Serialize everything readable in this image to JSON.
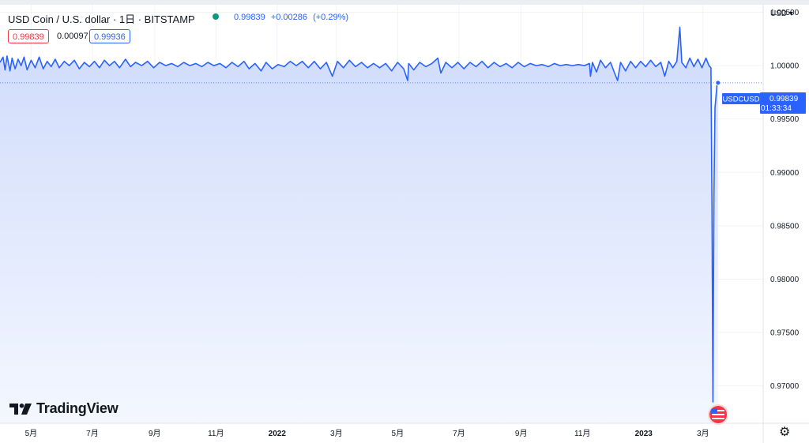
{
  "header": {
    "title": "USD Coin / U.S. dollar · 1日 · BITSTAMP",
    "last": "0.99839",
    "change": "+0.00286",
    "change_pct": "(+0.29%)",
    "bid": "0.99839",
    "spread": "0.00097",
    "ask": "0.99936",
    "currency": "USD"
  },
  "price_label": {
    "symbol": "USDCUSD",
    "price": "0.99839",
    "countdown": "01:33:34"
  },
  "brand": "TradingView",
  "colors": {
    "line": "#2962ff",
    "fill_top": "#cfdbfb",
    "fill_bottom": "#f4f7ff",
    "bid": "#f23645",
    "live": "#089981"
  },
  "chart_data": {
    "type": "area",
    "symbol": "USDCUSD",
    "ylim": [
      0.9665,
      1.0057
    ],
    "yticks": [
      "1.00500",
      "1.00000",
      "0.99500",
      "0.99000",
      "0.98500",
      "0.98000",
      "0.97500",
      "0.97000"
    ],
    "x_ticks": [
      {
        "label": "5月",
        "date": "2021-05-01"
      },
      {
        "label": "7月",
        "date": "2021-07-01"
      },
      {
        "label": "9月",
        "date": "2021-09-01"
      },
      {
        "label": "11月",
        "date": "2021-11-01"
      },
      {
        "label": "2022",
        "date": "2022-01-01"
      },
      {
        "label": "3月",
        "date": "2022-03-01"
      },
      {
        "label": "5月",
        "date": "2022-05-01"
      },
      {
        "label": "7月",
        "date": "2022-07-01"
      },
      {
        "label": "9月",
        "date": "2022-09-01"
      },
      {
        "label": "11月",
        "date": "2022-11-01"
      },
      {
        "label": "2023",
        "date": "2023-01-01"
      },
      {
        "label": "3月",
        "date": "2023-03-01"
      }
    ],
    "xlim": [
      "2021-03-31",
      "2023-04-30"
    ],
    "last_value": 0.99839,
    "series": [
      {
        "points": [
          [
            "2021-03-31",
            1.0003
          ],
          [
            "2021-04-03",
            1.0008
          ],
          [
            "2021-04-05",
            0.9996
          ],
          [
            "2021-04-07",
            1.0009
          ],
          [
            "2021-04-10",
            0.9995
          ],
          [
            "2021-04-12",
            1.0007
          ],
          [
            "2021-04-15",
            0.9997
          ],
          [
            "2021-04-18",
            1.0006
          ],
          [
            "2021-04-21",
            1.0
          ],
          [
            "2021-04-24",
            1.0008
          ],
          [
            "2021-04-27",
            0.9996
          ],
          [
            "2021-05-01",
            1.0005
          ],
          [
            "2021-05-05",
            0.9998
          ],
          [
            "2021-05-09",
            1.0008
          ],
          [
            "2021-05-13",
            0.9997
          ],
          [
            "2021-05-17",
            1.0004
          ],
          [
            "2021-05-21",
            0.9999
          ],
          [
            "2021-05-25",
            1.0006
          ],
          [
            "2021-05-29",
            0.9998
          ],
          [
            "2021-06-03",
            1.0004
          ],
          [
            "2021-06-08",
            1.0
          ],
          [
            "2021-06-13",
            1.0005
          ],
          [
            "2021-06-18",
            0.9997
          ],
          [
            "2021-06-23",
            1.0003
          ],
          [
            "2021-06-28",
            0.9999
          ],
          [
            "2021-07-03",
            1.0004
          ],
          [
            "2021-07-08",
            0.9998
          ],
          [
            "2021-07-13",
            1.0005
          ],
          [
            "2021-07-18",
            1.0
          ],
          [
            "2021-07-23",
            1.0004
          ],
          [
            "2021-07-28",
            0.9998
          ],
          [
            "2021-08-03",
            1.0006
          ],
          [
            "2021-08-08",
            0.9999
          ],
          [
            "2021-08-13",
            1.0003
          ],
          [
            "2021-08-19",
            1.0
          ],
          [
            "2021-08-25",
            1.0004
          ],
          [
            "2021-08-31",
            0.9998
          ],
          [
            "2021-09-06",
            1.0003
          ],
          [
            "2021-09-12",
            1.0
          ],
          [
            "2021-09-18",
            1.0002
          ],
          [
            "2021-09-24",
            0.9999
          ],
          [
            "2021-09-30",
            1.0003
          ],
          [
            "2021-10-06",
            1.0
          ],
          [
            "2021-10-12",
            1.0002
          ],
          [
            "2021-10-18",
            0.9999
          ],
          [
            "2021-10-24",
            1.0003
          ],
          [
            "2021-10-30",
            1.0
          ],
          [
            "2021-11-05",
            1.0002
          ],
          [
            "2021-11-11",
            0.9998
          ],
          [
            "2021-11-17",
            1.0003
          ],
          [
            "2021-11-23",
            0.9999
          ],
          [
            "2021-11-29",
            1.0004
          ],
          [
            "2021-12-04",
            0.9997
          ],
          [
            "2021-12-10",
            1.0002
          ],
          [
            "2021-12-16",
            0.9995
          ],
          [
            "2021-12-21",
            1.0003
          ],
          [
            "2021-12-27",
            0.9997
          ],
          [
            "2022-01-02",
            1.0001
          ],
          [
            "2022-01-08",
            0.9999
          ],
          [
            "2022-01-14",
            1.0004
          ],
          [
            "2022-01-20",
            1.0
          ],
          [
            "2022-01-26",
            1.0004
          ],
          [
            "2022-02-01",
            0.9998
          ],
          [
            "2022-02-07",
            1.0004
          ],
          [
            "2022-02-13",
            0.9997
          ],
          [
            "2022-02-19",
            1.0003
          ],
          [
            "2022-02-25",
            0.999
          ],
          [
            "2022-03-02",
            1.0004
          ],
          [
            "2022-03-08",
            0.9998
          ],
          [
            "2022-03-14",
            1.0005
          ],
          [
            "2022-03-20",
            0.9999
          ],
          [
            "2022-03-26",
            1.0003
          ],
          [
            "2022-04-01",
            0.9998
          ],
          [
            "2022-04-07",
            1.0002
          ],
          [
            "2022-04-13",
            0.9998
          ],
          [
            "2022-04-19",
            1.0002
          ],
          [
            "2022-04-25",
            0.9995
          ],
          [
            "2022-05-01",
            1.0003
          ],
          [
            "2022-05-07",
            0.9997
          ],
          [
            "2022-05-11",
            0.9986
          ],
          [
            "2022-05-12",
            1.0002
          ],
          [
            "2022-05-17",
            0.9996
          ],
          [
            "2022-05-23",
            1.0003
          ],
          [
            "2022-05-29",
            0.9999
          ],
          [
            "2022-06-04",
            1.0002
          ],
          [
            "2022-06-10",
            1.0007
          ],
          [
            "2022-06-13",
            0.9993
          ],
          [
            "2022-06-18",
            1.0003
          ],
          [
            "2022-06-24",
            0.9998
          ],
          [
            "2022-06-30",
            1.0003
          ],
          [
            "2022-07-06",
            0.9997
          ],
          [
            "2022-07-12",
            1.0003
          ],
          [
            "2022-07-18",
            0.9999
          ],
          [
            "2022-07-24",
            1.0004
          ],
          [
            "2022-07-30",
            0.9998
          ],
          [
            "2022-08-05",
            1.0003
          ],
          [
            "2022-08-11",
            0.9999
          ],
          [
            "2022-08-17",
            1.0002
          ],
          [
            "2022-08-23",
            0.9998
          ],
          [
            "2022-08-29",
            1.0003
          ],
          [
            "2022-09-04",
            0.9999
          ],
          [
            "2022-09-10",
            1.0002
          ],
          [
            "2022-09-16",
            1.0
          ],
          [
            "2022-09-22",
            1.0001
          ],
          [
            "2022-09-28",
            0.9999
          ],
          [
            "2022-10-04",
            1.0002
          ],
          [
            "2022-10-10",
            1.0
          ],
          [
            "2022-10-16",
            1.0001
          ],
          [
            "2022-10-22",
            1.0
          ],
          [
            "2022-10-28",
            1.0001
          ],
          [
            "2022-11-03",
            1.0
          ],
          [
            "2022-11-08",
            1.0002
          ],
          [
            "2022-11-09",
            0.999
          ],
          [
            "2022-11-11",
            1.0003
          ],
          [
            "2022-11-15",
            0.9994
          ],
          [
            "2022-11-19",
            1.0005
          ],
          [
            "2022-11-24",
            0.9998
          ],
          [
            "2022-11-29",
            1.0003
          ],
          [
            "2022-12-03",
            0.9993
          ],
          [
            "2022-12-06",
            0.9986
          ],
          [
            "2022-12-09",
            1.0003
          ],
          [
            "2022-12-14",
            0.9995
          ],
          [
            "2022-12-19",
            1.0004
          ],
          [
            "2022-12-24",
            0.9998
          ],
          [
            "2022-12-29",
            1.0004
          ],
          [
            "2023-01-03",
            0.9999
          ],
          [
            "2023-01-08",
            1.0005
          ],
          [
            "2023-01-13",
            0.9999
          ],
          [
            "2023-01-18",
            1.0003
          ],
          [
            "2023-01-22",
            0.999
          ],
          [
            "2023-01-26",
            1.0004
          ],
          [
            "2023-01-30",
            0.9998
          ],
          [
            "2023-02-03",
            1.0004
          ],
          [
            "2023-02-06",
            1.0036
          ],
          [
            "2023-02-08",
            1.0003
          ],
          [
            "2023-02-12",
            0.9998
          ],
          [
            "2023-02-16",
            1.0007
          ],
          [
            "2023-02-20",
            0.9999
          ],
          [
            "2023-02-24",
            1.0006
          ],
          [
            "2023-02-28",
            0.9998
          ],
          [
            "2023-03-04",
            1.0007
          ],
          [
            "2023-03-07",
            1.0
          ],
          [
            "2023-03-09",
            0.9998
          ],
          [
            "2023-03-10",
            0.987
          ],
          [
            "2023-03-11",
            0.9685
          ],
          [
            "2023-03-12",
            0.988
          ],
          [
            "2023-03-13",
            0.996
          ],
          [
            "2023-03-15",
            0.9982
          ],
          [
            "2023-03-16",
            0.99839
          ]
        ]
      }
    ]
  }
}
